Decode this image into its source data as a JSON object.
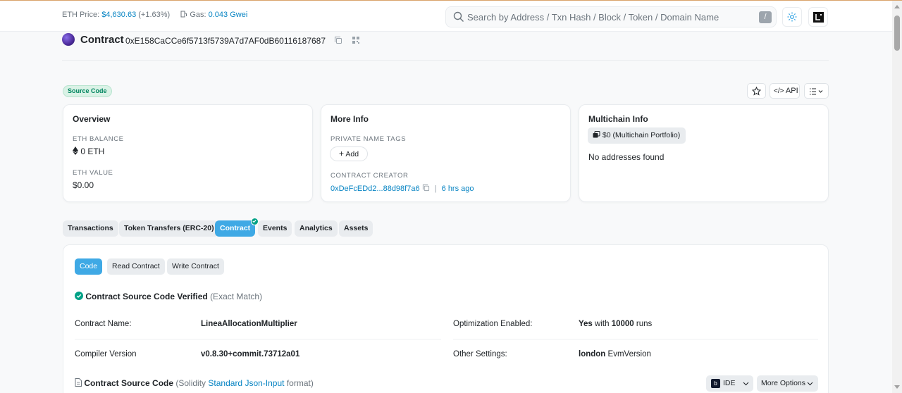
{
  "topbar": {
    "eth_price_label": "ETH Price:",
    "eth_price_value": "$4,630.63",
    "eth_price_change": "(+1.63%)",
    "gas_label": "Gas:",
    "gas_value": "0.043 Gwei",
    "search_placeholder": "Search by Address / Txn Hash / Block / Token / Domain Name",
    "search_shortcut": "/"
  },
  "header": {
    "title": "Contract",
    "address": "0xE158CaCCe6f5713f5739A7d7AF0dB60116187687"
  },
  "badge": "Source Code",
  "actions": {
    "api_label": "API"
  },
  "overview": {
    "title": "Overview",
    "eth_balance_label": "ETH BALANCE",
    "eth_balance_value": "0 ETH",
    "eth_value_label": "ETH VALUE",
    "eth_value_value": "$0.00"
  },
  "more_info": {
    "title": "More Info",
    "tags_label": "PRIVATE NAME TAGS",
    "add_label": "Add",
    "creator_label": "CONTRACT CREATOR",
    "creator_address": "0xDeFcEDd2...88d98f7a6",
    "creator_sep": "|",
    "creator_time": "6 hrs ago"
  },
  "multichain": {
    "title": "Multichain Info",
    "portfolio_label": "$0 (Multichain Portfolio)",
    "empty_text": "No addresses found"
  },
  "tabs": [
    {
      "label": "Transactions"
    },
    {
      "label": "Token Transfers (ERC-20)"
    },
    {
      "label": "Contract"
    },
    {
      "label": "Events"
    },
    {
      "label": "Analytics"
    },
    {
      "label": "Assets"
    }
  ],
  "subtabs": [
    {
      "label": "Code"
    },
    {
      "label": "Read Contract"
    },
    {
      "label": "Write Contract"
    }
  ],
  "verification": {
    "status": "Contract Source Code Verified",
    "match": "(Exact Match)"
  },
  "details": {
    "name_label": "Contract Name:",
    "name_value": "LineaAllocationMultiplier",
    "optimization_label": "Optimization Enabled:",
    "optimization_yes": "Yes",
    "optimization_with": "with",
    "optimization_runs": "10000",
    "optimization_runs_suffix": "runs",
    "compiler_label": "Compiler Version",
    "compiler_value": "v0.8.30+commit.73712a01",
    "settings_label": "Other Settings:",
    "settings_value": "london",
    "settings_suffix": "EvmVersion"
  },
  "source": {
    "title": "Contract Source Code",
    "paren_open": "(Solidity",
    "format_link": "Standard Json-Input",
    "paren_close": "format)",
    "ide_label": "IDE",
    "more_options_label": "More Options"
  },
  "colors": {
    "accent": "#3fa9e5",
    "link": "#0784c3",
    "success": "#00a186"
  }
}
